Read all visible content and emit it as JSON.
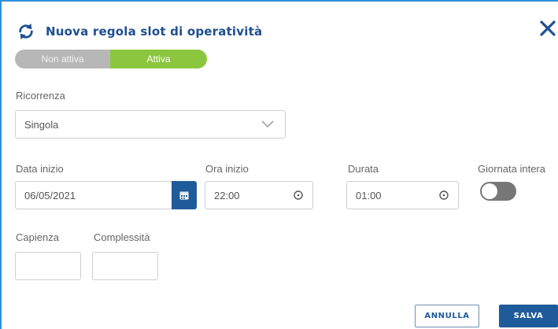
{
  "dialog": {
    "title": "Nuova regola slot di operatività",
    "title_icon": "sync-icon",
    "close_icon": "close-icon",
    "accent": "#1f5b9a"
  },
  "status_toggle": {
    "inactive_label": "Non attiva",
    "active_label": "Attiva",
    "selected": "Attiva",
    "inactive_color": "#b7b7b7",
    "active_color": "#8cc63f"
  },
  "recurrence": {
    "label": "Ricorrenza",
    "value": "Singola"
  },
  "start_date": {
    "label": "Data inizio",
    "value": "06/05/2021",
    "icon": "calendar-icon"
  },
  "start_time": {
    "label": "Ora inizio",
    "value": "22:00",
    "icon": "clock-icon"
  },
  "duration": {
    "label": "Durata",
    "value": "01:00",
    "icon": "clock-icon"
  },
  "full_day": {
    "label": "Giornata intera",
    "checked": false
  },
  "capacity": {
    "label": "Capienza",
    "value": ""
  },
  "complexity": {
    "label": "Complessità",
    "value": ""
  },
  "actions": {
    "cancel_label": "ANNULLA",
    "save_label": "SALVA"
  }
}
